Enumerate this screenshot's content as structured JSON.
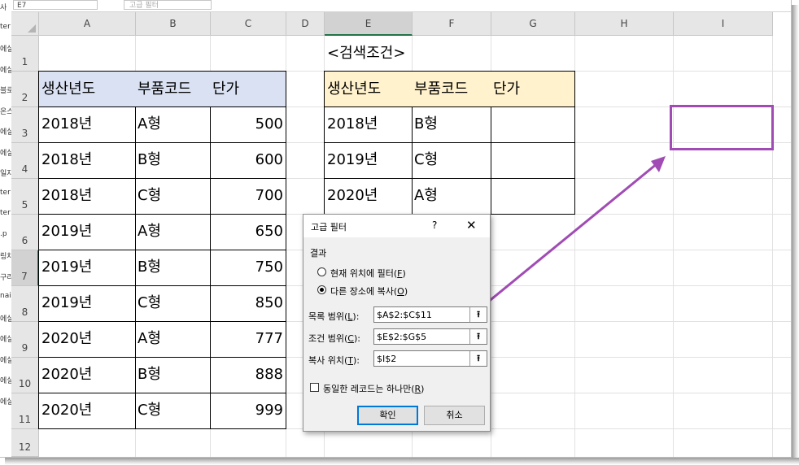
{
  "name_box": "E7",
  "formula_hint": "고급 필터",
  "left_strip_fragments": [
    "사",
    "ter",
    "에실",
    "에실",
    "블로",
    "온스",
    "에실",
    "에실",
    "일자",
    "ter",
    "ter",
    ".p",
    "링차",
    "구리",
    "nai",
    "에실",
    "에실",
    "에실",
    "에실",
    "에실"
  ],
  "columns": [
    "A",
    "B",
    "C",
    "D",
    "E",
    "F",
    "G",
    "H",
    "I"
  ],
  "rows": [
    "1",
    "2",
    "3",
    "4",
    "5",
    "6",
    "7",
    "8",
    "9",
    "10",
    "11",
    "12"
  ],
  "selected_column": "E",
  "selected_row": "7",
  "source_table": {
    "headers": [
      "생산년도",
      "부품코드",
      "단가"
    ],
    "rows": [
      [
        "2018년",
        "A형",
        "500"
      ],
      [
        "2018년",
        "B형",
        "600"
      ],
      [
        "2018년",
        "C형",
        "700"
      ],
      [
        "2019년",
        "A형",
        "650"
      ],
      [
        "2019년",
        "B형",
        "750"
      ],
      [
        "2019년",
        "C형",
        "850"
      ],
      [
        "2020년",
        "A형",
        "777"
      ],
      [
        "2020년",
        "B형",
        "888"
      ],
      [
        "2020년",
        "C형",
        "999"
      ]
    ]
  },
  "criteria_title": "<검색조건>",
  "criteria_table": {
    "headers": [
      "생산년도",
      "부품코드",
      "단가"
    ],
    "rows": [
      [
        "2018년",
        "B형",
        ""
      ],
      [
        "2019년",
        "C형",
        ""
      ],
      [
        "2020년",
        "A형",
        ""
      ]
    ]
  },
  "dialog": {
    "title": "고급 필터",
    "help": "?",
    "close": "✕",
    "group_label": "결과",
    "option1": {
      "text": "현재 위치에 필터",
      "key": "F",
      "selected": false
    },
    "option2": {
      "text": "다른 장소에 복사",
      "key": "O",
      "selected": true
    },
    "list_range": {
      "label": "목록 범위",
      "key": "L",
      "value": "$A$2:$C$11"
    },
    "criteria_range": {
      "label": "조건 범위",
      "key": "C",
      "value": "$E$2:$G$5"
    },
    "copy_to": {
      "label": "복사 위치",
      "key": "T",
      "value": "$I$2"
    },
    "unique_only": {
      "label": "동일한 레코드는 하나만",
      "key": "R",
      "checked": false
    },
    "ok": "확인",
    "cancel": "취소",
    "collapse_icon": "⭱"
  },
  "annotation_color": "#a04cb4"
}
